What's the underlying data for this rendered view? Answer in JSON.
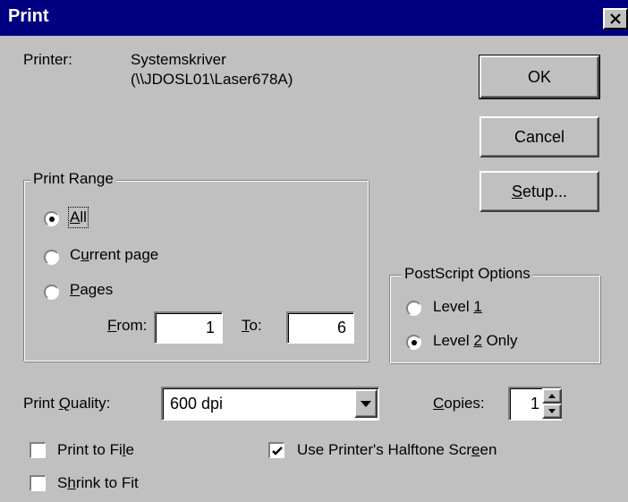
{
  "dialog": {
    "title": "Print"
  },
  "printer": {
    "label": "Printer:",
    "name": "Systemskriver",
    "path": "(\\\\JDOSL01\\Laser678A)"
  },
  "buttons": {
    "ok": "OK",
    "cancel": "Cancel",
    "setup_pre": "",
    "setup_key": "S",
    "setup_post": "etup..."
  },
  "print_range": {
    "label": "Print Range",
    "all": {
      "key": "A",
      "rest": "ll",
      "selected": true
    },
    "current": {
      "pre": "C",
      "key": "u",
      "post": "rrent page",
      "selected": false
    },
    "pages": {
      "key": "P",
      "rest": "ages",
      "selected": false
    },
    "from": {
      "key": "F",
      "rest": "rom:",
      "value": "1"
    },
    "to": {
      "key": "T",
      "rest": "o:",
      "value": "6"
    }
  },
  "postscript": {
    "label": "PostScript Options",
    "level1": {
      "pre": "Level ",
      "key": "1",
      "post": "",
      "selected": false
    },
    "level2": {
      "pre": "Level ",
      "key": "2",
      "post": " Only",
      "selected": true
    }
  },
  "quality": {
    "pre": "Print ",
    "key": "Q",
    "post": "uality:",
    "value": "600 dpi"
  },
  "copies": {
    "key": "C",
    "rest": "opies:",
    "value": "1"
  },
  "options": {
    "print_to_file": {
      "pre": "Print to Fi",
      "key": "l",
      "post": "e",
      "checked": false
    },
    "halftone": {
      "pre": "Use Printer's Halftone Scr",
      "key": "e",
      "post": "en",
      "checked": true
    },
    "shrink": {
      "pre": "S",
      "key": "h",
      "post": "rink to Fit",
      "checked": false
    }
  }
}
